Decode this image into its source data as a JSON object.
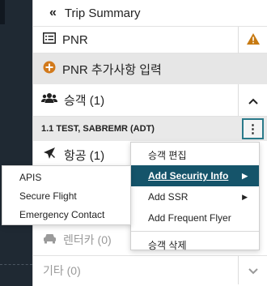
{
  "header": {
    "title": "Trip Summary",
    "collapse_icon": "double-chevron-left-icon"
  },
  "pnr": {
    "label": "PNR",
    "warning_icon": "warning-icon",
    "warning_color": "#c77a12"
  },
  "pnr_add": {
    "label": "PNR 추가사항 입력",
    "plus_color": "#d27a1c"
  },
  "passengers": {
    "label": "승객 (1)",
    "toggle": "^"
  },
  "passenger_item": {
    "label": "1.1 TEST, SABREMR (ADT)",
    "kebab": "⋮"
  },
  "air": {
    "label": "항공 (1)"
  },
  "car": {
    "label": "렌터카 (0)"
  },
  "other": {
    "label": "기타 (0)",
    "toggle": "⌄"
  },
  "context_menu": {
    "items": [
      {
        "label": "승객 편집"
      },
      {
        "label": "Add Security Info",
        "submenu": true,
        "active": true
      },
      {
        "label": "Add SSR",
        "submenu": true
      },
      {
        "label": "Add Frequent Flyer"
      },
      {
        "label": "승객 삭제"
      }
    ],
    "arrow": "▶"
  },
  "security_submenu": {
    "items": [
      {
        "label": "APIS"
      },
      {
        "label": "Secure Flight"
      },
      {
        "label": "Emergency Contact"
      }
    ]
  },
  "colors": {
    "accent": "#15546a",
    "focus_border": "#2a7a8a",
    "sidebar_dark": "#1f2933"
  }
}
